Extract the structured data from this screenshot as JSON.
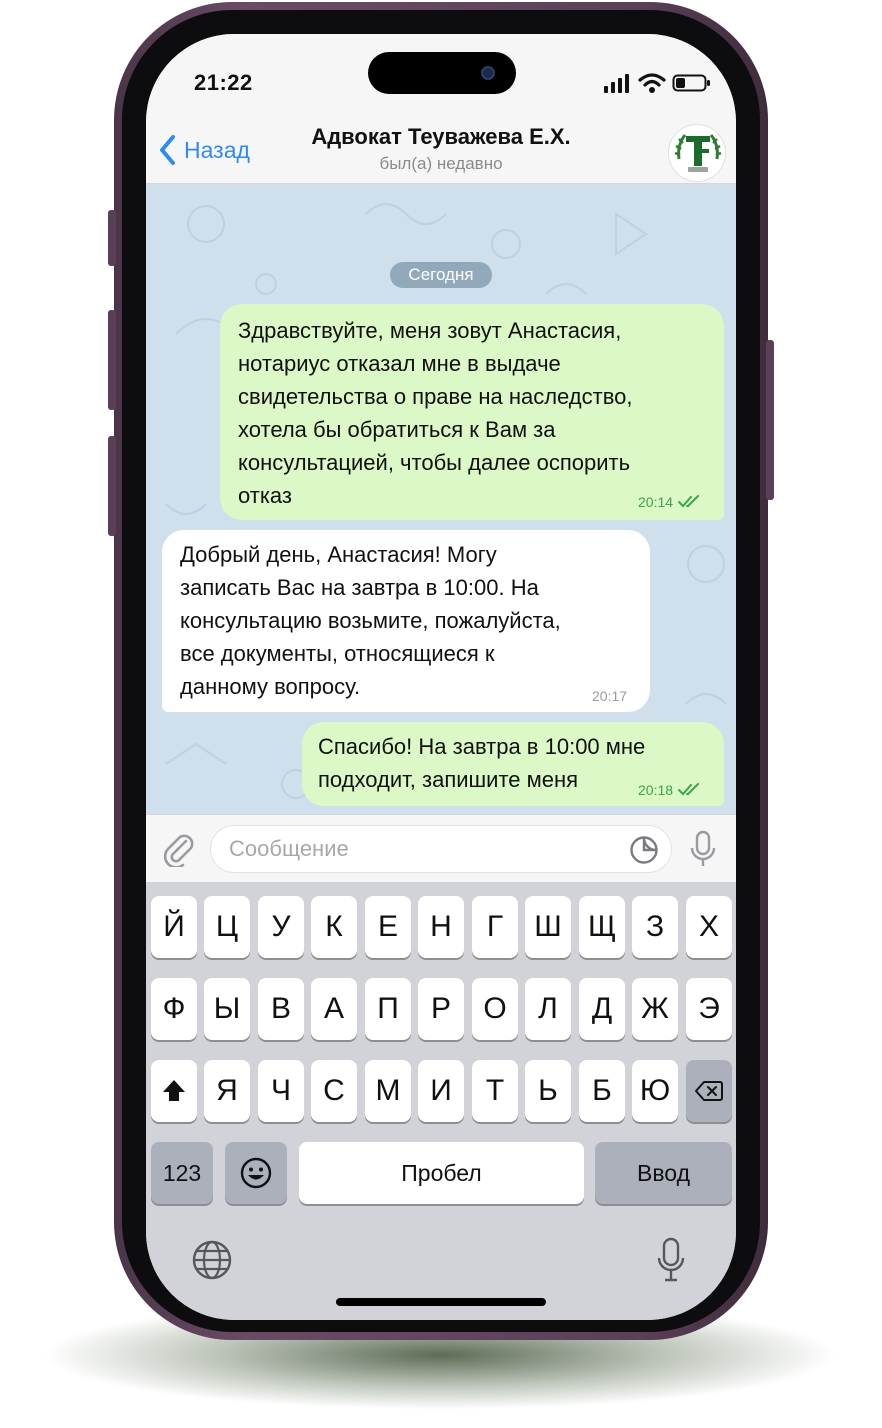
{
  "status_bar": {
    "time": "21:22"
  },
  "header": {
    "back_label": "Назад",
    "contact_name": "Адвокат Теуважева Е.Х.",
    "contact_status": "был(а) недавно"
  },
  "chat": {
    "date_separator": "Сегодня",
    "messages": [
      {
        "direction": "outgoing",
        "text": "Здравствуйте, меня зовут Анастасия,\nнотариус отказал мне в выдаче\nсвидетельства о праве на наследство,\nхотела бы обратиться к Вам за\nконсультацией, чтобы далее оспорить\nотказ",
        "time": "20:14",
        "read": true
      },
      {
        "direction": "incoming",
        "text": "Добрый день, Анастасия! Могу\nзаписать Вас на завтра в 10:00. На\nконсультацию возьмите, пожалуйста,\nвсе документы, относящиеся к\nданному вопросу.",
        "time": "20:17"
      },
      {
        "direction": "outgoing",
        "text": "Спасибо! На завтра в 10:00 мне\nподходит, запишите меня",
        "time": "20:18",
        "read": true
      }
    ]
  },
  "input_bar": {
    "placeholder": "Сообщение"
  },
  "keyboard": {
    "row1": [
      "Й",
      "Ц",
      "У",
      "К",
      "Е",
      "Н",
      "Г",
      "Ш",
      "Щ",
      "З",
      "Х"
    ],
    "row2": [
      "Ф",
      "Ы",
      "В",
      "А",
      "П",
      "Р",
      "О",
      "Л",
      "Д",
      "Ж",
      "Э"
    ],
    "row3": [
      "Я",
      "Ч",
      "С",
      "М",
      "И",
      "Т",
      "Ь",
      "Б",
      "Ю"
    ],
    "numbers_label": "123",
    "space_label": "Пробел",
    "return_label": "Ввод"
  },
  "colors": {
    "accent": "#2f8bf0",
    "outgoing_bubble": "#dcf8c6",
    "incoming_bubble": "#ffffff",
    "chat_background": "#cfdfeb",
    "read_check": "#3aa54a"
  }
}
